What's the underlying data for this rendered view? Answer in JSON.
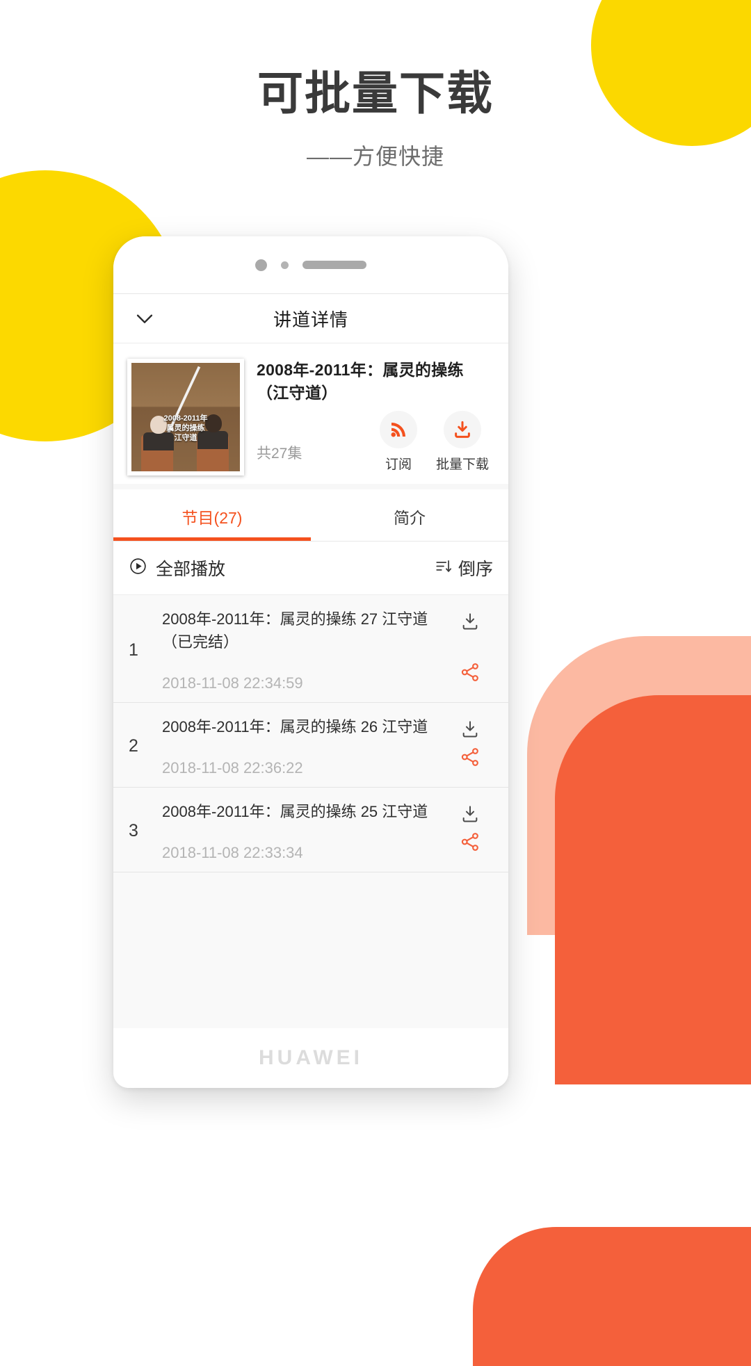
{
  "promo": {
    "headline": "可批量下载",
    "subheadline": "——方便快捷"
  },
  "colors": {
    "accent_orange": "#f4511e",
    "brand_yellow": "#fbd800",
    "brand_red": "#f4603b",
    "brand_peach": "#fcb9a2"
  },
  "phone": {
    "status": {
      "camera_icon": "camera-dot-icon",
      "sensor_icon": "sensor-dot-icon",
      "speaker_icon": "speaker-bar-icon"
    },
    "footer_wordmark": "HUAWEI"
  },
  "app": {
    "header": {
      "title": "讲道详情",
      "back_icon": "chevron-down-icon"
    },
    "detail": {
      "cover_caption_line1": "2008-2011年",
      "cover_caption_line2": "属灵的操练",
      "cover_caption_line3": "江守道",
      "title": "2008年-2011年：属灵的操练（江守道）",
      "episode_count": "共27集",
      "actions": [
        {
          "label": "订阅",
          "icon": "rss-icon"
        },
        {
          "label": "批量下载",
          "icon": "download-box-icon"
        }
      ]
    },
    "tabs": [
      {
        "label": "节目(27)",
        "active": true
      },
      {
        "label": "简介",
        "active": false
      }
    ],
    "playall": {
      "label": "全部播放",
      "play_icon": "play-circle-icon",
      "order_label": "倒序",
      "order_icon": "sort-descending-icon"
    },
    "episodes": [
      {
        "index": "1",
        "title": "2008年-2011年：属灵的操练 27 江守道（已完结）",
        "time": "2018-11-08 22:34:59",
        "download_icon": "download-icon",
        "share_icon": "share-icon"
      },
      {
        "index": "2",
        "title": "2008年-2011年：属灵的操练 26 江守道",
        "time": "2018-11-08 22:36:22",
        "download_icon": "download-icon",
        "share_icon": "share-icon"
      },
      {
        "index": "3",
        "title": "2008年-2011年：属灵的操练 25 江守道",
        "time": "2018-11-08 22:33:34",
        "download_icon": "download-icon",
        "share_icon": "share-icon"
      }
    ]
  }
}
